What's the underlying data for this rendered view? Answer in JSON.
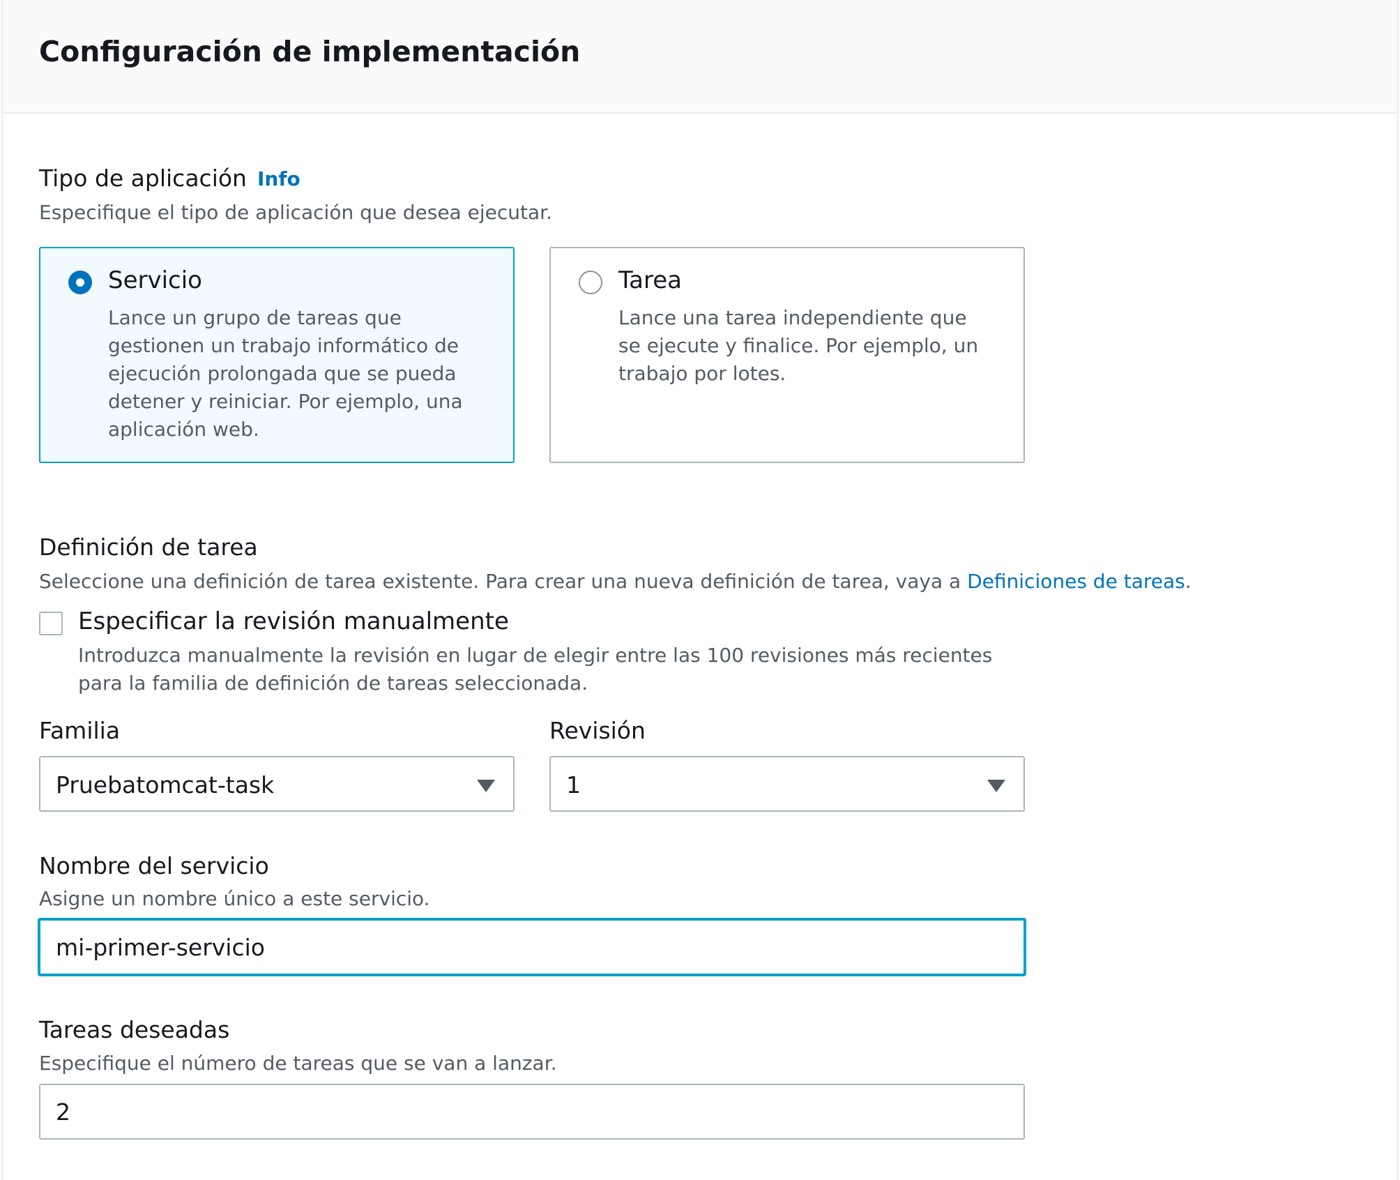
{
  "header": {
    "title": "Configuración de implementación"
  },
  "app_type": {
    "label": "Tipo de aplicación",
    "info_link": "Info",
    "description": "Especifique el tipo de aplicación que desea ejecutar.",
    "options": [
      {
        "title": "Servicio",
        "description": "Lance un grupo de tareas que gestionen un trabajo informático de ejecución prolongada que se pueda detener y reiniciar. Por ejemplo, una aplicación web.",
        "selected": true
      },
      {
        "title": "Tarea",
        "description": "Lance una tarea independiente que se ejecute y finalice. Por ejemplo, un trabajo por lotes.",
        "selected": false
      }
    ]
  },
  "task_definition": {
    "label": "Definición de tarea",
    "description_prefix": "Seleccione una definición de tarea existente. Para crear una nueva definición de tarea, vaya a ",
    "description_link": "Definiciones de tareas",
    "description_suffix": ".",
    "manual_revision": {
      "label": "Especificar la revisión manualmente",
      "description": "Introduzca manualmente la revisión en lugar de elegir entre las 100 revisiones más recientes para la familia de definición de tareas seleccionada.",
      "checked": false
    },
    "family": {
      "label": "Familia",
      "value": "Pruebatomcat-task",
      "icon": "caret-down-icon"
    },
    "revision": {
      "label": "Revisión",
      "value": "1",
      "icon": "caret-down-icon"
    }
  },
  "service_name": {
    "label": "Nombre del servicio",
    "description": "Asigne un nombre único a este servicio.",
    "value": "mi-primer-servicio"
  },
  "desired_tasks": {
    "label": "Tareas deseadas",
    "description": "Especifique el número de tareas que se van a lanzar.",
    "value": "2"
  },
  "colors": {
    "accent": "#0073bb",
    "focus_border": "#00a1c9",
    "selected_tile_bg": "#f1faff",
    "border": "#aab7b8",
    "secondary_text": "#545b64"
  }
}
